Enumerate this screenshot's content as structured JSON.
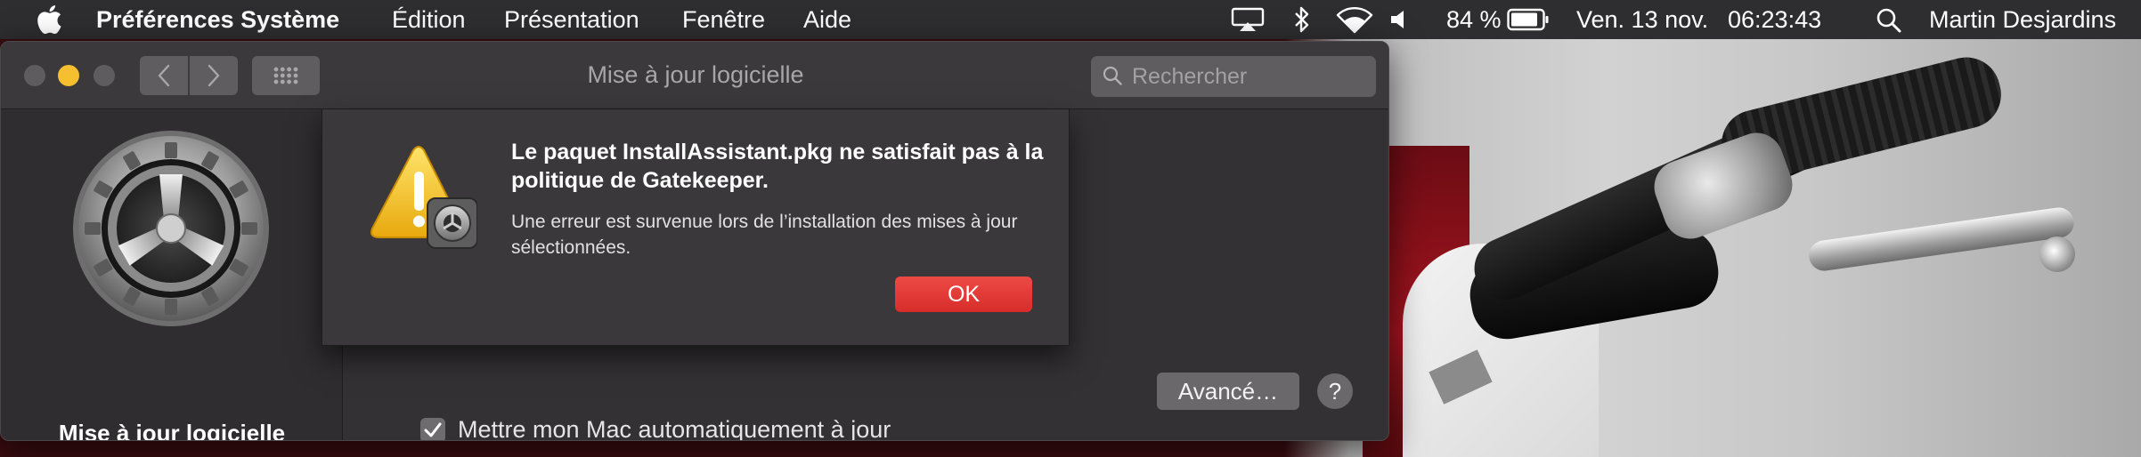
{
  "menubar": {
    "app_name": "Préférences Système",
    "items": [
      "Édition",
      "Présentation",
      "Fenêtre",
      "Aide"
    ],
    "battery_percent": "84 %",
    "date": "Ven. 13 nov.",
    "time": "06:23:43",
    "user": "Martin Desjardins"
  },
  "window": {
    "title": "Mise à jour logicielle",
    "search_placeholder": "Rechercher"
  },
  "sidebar": {
    "title": "Mise à jour logicielle"
  },
  "alert": {
    "title": "Le paquet InstallAssistant.pkg ne satisfait pas à la politique de Gatekeeper.",
    "message": "Une erreur est survenue lors de l’installation des mises à jour sélectionnées.",
    "ok_label": "OK"
  },
  "pane": {
    "auto_update_label": "Mettre mon Mac automatiquement à jour",
    "auto_update_checked": true,
    "advanced_label": "Avancé…",
    "help_label": "?"
  }
}
